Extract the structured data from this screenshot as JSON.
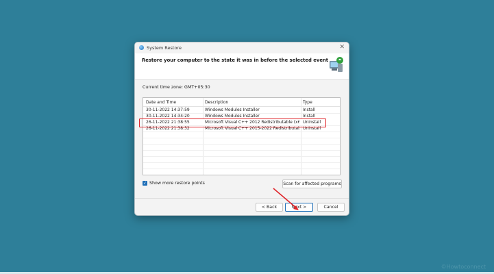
{
  "dialog": {
    "title": "System Restore",
    "close_glyph": "✕",
    "heading": "Restore your computer to the state it was in before the selected event",
    "timezone": "Current time zone: GMT+05:30",
    "table": {
      "columns": [
        "Date and Time",
        "Description",
        "Type"
      ],
      "rows": [
        {
          "date": "30-11-2022 14:37:59",
          "description": "Windows Modules Installer",
          "type": "Install"
        },
        {
          "date": "30-11-2022 14:34:20",
          "description": "Windows Modules Installer",
          "type": "Install"
        },
        {
          "date": "26-11-2022 21:38:55",
          "description": "Microsoft Visual C++ 2012 Redistributable (x64) ...",
          "type": "Uninstall"
        },
        {
          "date": "26-11-2022 21:38:32",
          "description": "Microsoft Visual C++ 2015-2022 Redistributable ...",
          "type": "Uninstall"
        }
      ],
      "selected_row_index": 2
    },
    "show_more_label": "Show more restore points",
    "show_more_checked": true,
    "scan_button": "Scan for affected programs",
    "back_button": "< Back",
    "next_button": "Next >",
    "cancel_button": "Cancel"
  },
  "watermark": "©Howtoconnect",
  "colors": {
    "desktop": "#2e7f99",
    "accent": "#1f6fb8",
    "highlight": "#e0262b"
  }
}
